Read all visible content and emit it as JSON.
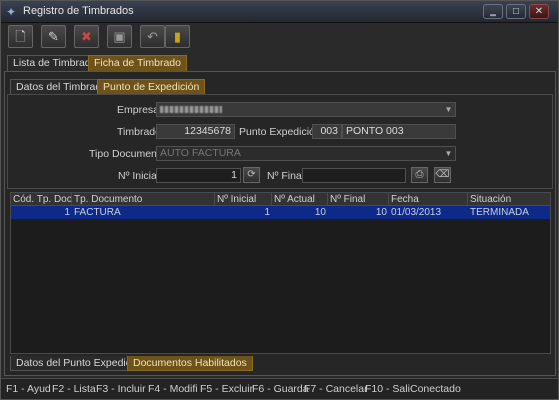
{
  "window": {
    "title": "Registro de Timbrados"
  },
  "toolbar": {
    "icons": [
      "new-document-icon",
      "edit-icon",
      "delete-icon",
      "save-icon",
      "cancel-icon",
      "exit-icon"
    ]
  },
  "tabs_main": [
    "Lista de Timbrados",
    "Ficha de Timbrado"
  ],
  "tabs_sub": [
    "Datos del Timbrado",
    "Punto de Expedición"
  ],
  "form": {
    "empresa_label": "Empresa",
    "timbrado_label": "Timbrado",
    "timbrado_value": "12345678",
    "punto_label": "Punto Expedición",
    "punto_code": "003",
    "punto_name": "PONTO 003",
    "tipo_doc_label": "Tipo Documento",
    "tipo_doc_value": "AUTO FACTURA",
    "n_inicial_label": "Nº Inicial",
    "n_inicial_value": "1",
    "n_final_label": "Nº Final",
    "n_final_value": ""
  },
  "grid": {
    "headers": [
      "Cód. Tp. Doc.",
      "Tp. Documento",
      "Nº Inicial",
      "Nº Actual",
      "Nº Final",
      "Fecha",
      "Situación"
    ],
    "rows": [
      [
        "1",
        "FACTURA",
        "1",
        "10",
        "10",
        "01/03/2013",
        "TERMINADA"
      ]
    ]
  },
  "tabs_bottom": [
    "Datos del Punto Expedición",
    "Documentos Habilitados"
  ],
  "statusbar": {
    "items": [
      "F1 - Ayud",
      "F2 - Lista",
      "F3 - Incluir",
      "F4 - Modifi",
      "F5 - Excluir",
      "F6 - Guarda",
      "F7 - Cancelar",
      "F10 - Sali",
      "Conectado"
    ]
  },
  "colors": {
    "accent_tab": "#6d5319",
    "selected_row": "#0d2a88"
  }
}
